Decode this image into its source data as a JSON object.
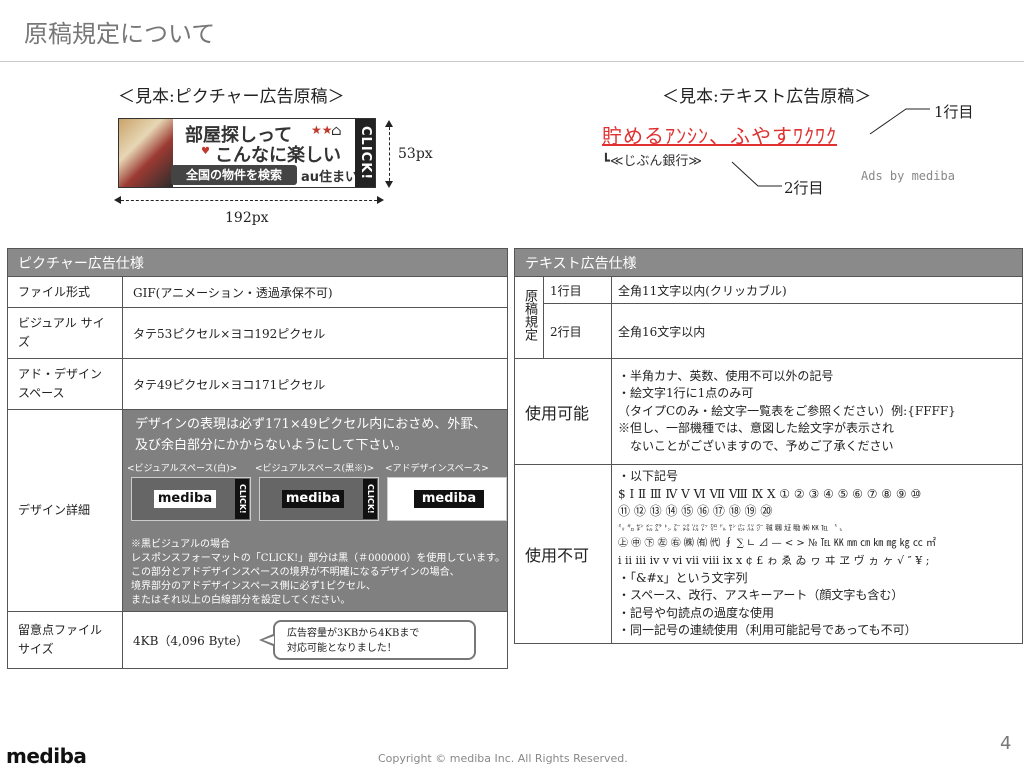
{
  "page": {
    "title": "原稿規定について",
    "number": "4"
  },
  "picture_sample": {
    "caption": "＜見本:ピクチャー広告原稿＞",
    "line1": "部屋探しって",
    "line2": "こんなに楽しい",
    "stars": "★★",
    "search_label": "全国の物件を検索",
    "brand": "au住まい",
    "click": "CLICK!",
    "height_label": "53px",
    "width_label": "192px"
  },
  "text_sample": {
    "caption": "＜見本:テキスト広告原稿＞",
    "line1": "貯めるｱﾝｼﾝ、ふやすﾜｸﾜｸ",
    "line2": "┗≪じぶん銀行≫",
    "line1_label": "1行目",
    "line2_label": "2行目",
    "ads_by": "Ads by mediba"
  },
  "picture_spec": {
    "header": "ピクチャー広告仕様",
    "rows": [
      {
        "key": "ファイル形式",
        "value": "GIF(アニメーション・透過承保不可)"
      },
      {
        "key": "ビジュアル サイズ",
        "value": "タテ53ピクセル×ヨコ192ピクセル"
      },
      {
        "key": "アド・デザイン スペース",
        "value": "タテ49ピクセル×ヨコ171ピクセル"
      }
    ],
    "design": {
      "key": "デザイン詳細",
      "intro1": "デザインの表現は必ず171×49ピクセル内におさめ、外罫、",
      "intro2": "及び余白部分にかからないようにして下さい。",
      "cap1": "<ビジュアルスペース(白)>",
      "cap2": "<ビジュアルスペース(黒※)>",
      "cap3": "<アドデザインスペース>",
      "logo": "mediba",
      "click": "CLICK!",
      "note": [
        "※黒ビジュアルの場合",
        "レスポンスフォーマットの「CLICK!」部分は黒（＃000000）を使用しています。",
        "この部分とアドデザインスペースの境界が不明確になるデザインの場合、",
        "境界部分のアドデザインスペース側に必ず1ピクセル、",
        "またはそれ以上の白線部分を設定してください。"
      ]
    },
    "size": {
      "key": "留意点ファイル サイズ",
      "value": "4KB（4,096 Byte）",
      "bubble1": "広告容量が3KBから4KBまで",
      "bubble2": "対応可能となりました！"
    }
  },
  "text_spec": {
    "header": "テキスト広告仕様",
    "group_label": "原稿規定",
    "row1": {
      "key": "1行目",
      "value": "全角11文字以内(クリッカブル)"
    },
    "row2": {
      "key": "2行目",
      "value": "全角16文字以内"
    },
    "allowed": {
      "key": "使用可能",
      "lines": [
        "・半角カナ、英数、使用不可以外の記号",
        "・絵文字1行に1点のみ可",
        "（タイプCのみ・絵文字一覧表をご参照ください）例:{FFFF}",
        "※但し、一部機種では、意図した絵文字が表示され",
        "　ないことがございますので、予めご了承ください"
      ]
    },
    "forbidden": {
      "key": "使用不可",
      "lines": [
        "・以下記号",
        "$ Ⅰ Ⅱ Ⅲ Ⅳ Ⅴ Ⅵ Ⅶ Ⅷ Ⅸ Ⅹ ① ② ③ ④ ⑤ ⑥ ⑦ ⑧ ⑨ ⑩",
        "⑪ ⑫ ⑬ ⑭ ⑮ ⑯ ⑰ ⑱ ⑲ ⑳",
        "㍉ ㌔ ㌢ ㍍ ㌘ ㌧ ㌃ ㌶ ㍑ ㍗ ㌍ ㌦ ㌣ ㌫ ㍊ ㌻ ㍻ ㍼ ㍽ ㍾ ㈱ ㏍ ℡ 〝 〟",
        "㊤ ㊥ ㊦ ㊧ ㊨ ㈱ ㈲ ㈹ ∮ ∑ ∟ ⊿ — < > № ℡ ㏍ ㎜ ㎝ ㎞ ㎎ ㎏ ㏄ ㎡",
        "ⅰ ⅱ ⅲ ⅳ ⅴ ⅵ ⅶ ⅷ ⅸ ⅹ ¢ £ ゎ ゑ ゐ ヮ ヰ ヱ ヴ ヵ ヶ √ ″ ¥ ;",
        "・「&#x」という文字列",
        "・スペース、改行、アスキーアート（顔文字も含む）",
        "・記号や句読点の過度な使用",
        "・同一記号の連続使用（利用可能記号であっても不可）"
      ]
    }
  },
  "footer": {
    "logo": "mediba",
    "copyright": "Copyright © mediba Inc. All Rights Reserved."
  }
}
